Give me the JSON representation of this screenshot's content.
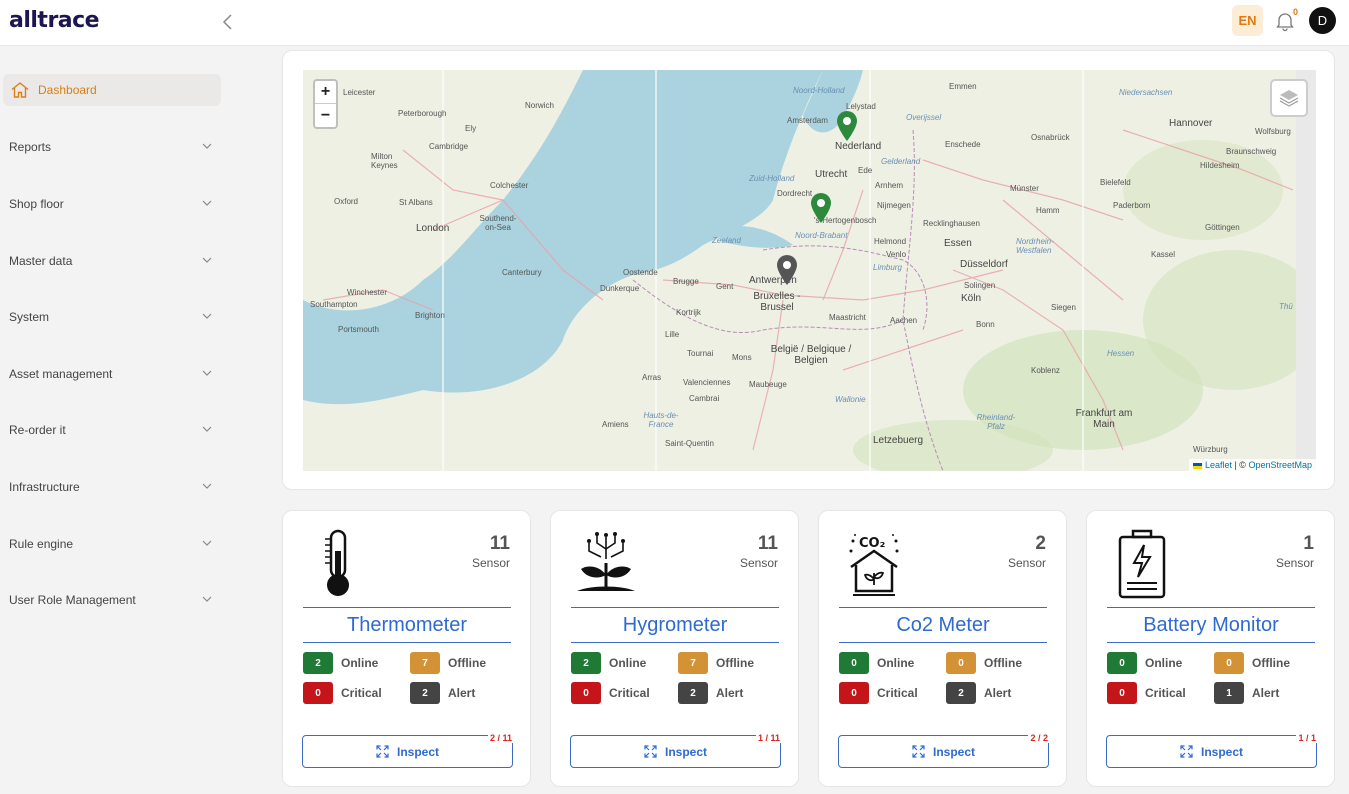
{
  "header": {
    "logo": "alltrace",
    "collapse_icon": "chevron-left-icon",
    "language": "EN",
    "notification_count": "0",
    "avatar_initial": "D",
    "accent_color": "#e07a10"
  },
  "sidebar": {
    "items": [
      {
        "label": "Dashboard",
        "active": true
      },
      {
        "label": "Reports"
      },
      {
        "label": "Shop floor"
      },
      {
        "label": "Master data"
      },
      {
        "label": "System"
      },
      {
        "label": "Asset management"
      },
      {
        "label": "Re-order it"
      },
      {
        "label": "Infrastructure"
      },
      {
        "label": "Rule engine"
      },
      {
        "label": "User Role Management"
      }
    ]
  },
  "map": {
    "zoom_in": "+",
    "zoom_out": "−",
    "attribution_leaflet": "Leaflet",
    "attribution_sep": " | © ",
    "attribution_osm": "OpenStreetMap",
    "labels": [
      "Leicester",
      "Norwich",
      "Peterborough",
      "Ely",
      "Cambridge",
      "Milton Keynes",
      "Colchester",
      "Oxford",
      "St Albans",
      "London",
      "Southend-on-Sea",
      "Canterbury",
      "Winchester",
      "Southampton",
      "Portsmouth",
      "Brighton",
      "Oostende",
      "Dunkerque",
      "Brugge",
      "Gent",
      "Antwerpen",
      "Bruxelles - Brussel",
      "Kortrijk",
      "Lille",
      "Tournai",
      "Mons",
      "België / Belgique / Belgien",
      "Arras",
      "Valenciennes",
      "Maubeuge",
      "Cambrai",
      "Amiens",
      "Saint-Quentin",
      "Amsterdam",
      "Nederland",
      "Utrecht",
      "Dordrecht",
      "'s-Hertogenbosch",
      "Arnhem",
      "Nijmegen",
      "Helmond",
      "Venlo",
      "Maastricht",
      "Aachen",
      "Essen",
      "Düsseldorf",
      "Köln",
      "Solingen",
      "Bonn",
      "Siegen",
      "Koblenz",
      "Frankfurt am Main",
      "Letzebuerg",
      "Münster",
      "Bielefeld",
      "Hamm",
      "Paderborn",
      "Hannover",
      "Wolfsburg",
      "Braunschweig",
      "Hildesheim",
      "Osnabrück",
      "Enschede",
      "Emmen",
      "Lelystad",
      "Göttingen",
      "Kassel",
      "Recklinghausen",
      "Würzburg",
      "Ede"
    ],
    "region_labels": [
      "Noord-Holland",
      "Overijssel",
      "Gelderland",
      "Zuid-Holland",
      "Noord-Brabant",
      "Zeeland",
      "Limburg",
      "Niedersachsen",
      "Nordrhein-Westfalen",
      "Hessen",
      "Wallonie",
      "Hauts-de-France",
      "Rheinland-Pfalz",
      "Thü"
    ],
    "markers": [
      {
        "name": "marker-amsterdam",
        "color": "#2d8a3c"
      },
      {
        "name": "marker-den-bosch",
        "color": "#2d8a3c"
      },
      {
        "name": "marker-antwerp",
        "color": "#555555"
      }
    ]
  },
  "cards": [
    {
      "icon": "thermometer-icon",
      "count": "11",
      "unit": "Sensor",
      "title": "Thermometer",
      "online": "2",
      "online_label": "Online",
      "offline": "7",
      "offline_label": "Offline",
      "critical": "0",
      "critical_label": "Critical",
      "alert": "2",
      "alert_label": "Alert",
      "inspect": "Inspect",
      "ratio": "2 / 11"
    },
    {
      "icon": "hygrometer-icon",
      "count": "11",
      "unit": "Sensor",
      "title": "Hygrometer",
      "online": "2",
      "online_label": "Online",
      "offline": "7",
      "offline_label": "Offline",
      "critical": "0",
      "critical_label": "Critical",
      "alert": "2",
      "alert_label": "Alert",
      "inspect": "Inspect",
      "ratio": "1 / 11"
    },
    {
      "icon": "co2-meter-icon",
      "count": "2",
      "unit": "Sensor",
      "title": "Co2 Meter",
      "online": "0",
      "online_label": "Online",
      "offline": "0",
      "offline_label": "Offline",
      "critical": "0",
      "critical_label": "Critical",
      "alert": "2",
      "alert_label": "Alert",
      "inspect": "Inspect",
      "ratio": "2 / 2"
    },
    {
      "icon": "battery-monitor-icon",
      "count": "1",
      "unit": "Sensor",
      "title": "Battery Monitor",
      "online": "0",
      "online_label": "Online",
      "offline": "0",
      "offline_label": "Offline",
      "critical": "0",
      "critical_label": "Critical",
      "alert": "1",
      "alert_label": "Alert",
      "inspect": "Inspect",
      "ratio": "1 / 1"
    }
  ],
  "colors": {
    "online": "#1f7a35",
    "offline": "#d39236",
    "critical": "#c4151b",
    "alert": "#444444",
    "title": "#2f6ad0"
  }
}
